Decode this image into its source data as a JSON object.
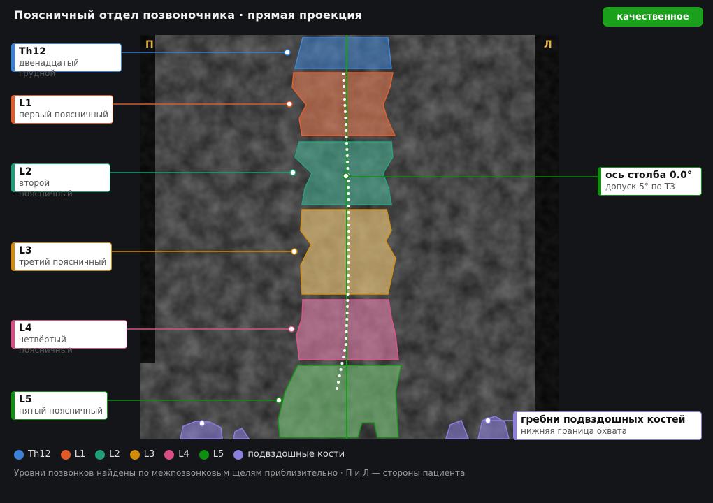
{
  "title": "Поясничный отдел позвоночника · прямая проекция",
  "badge": "качественное",
  "side_right": "П",
  "side_left": "Л",
  "vertebrae": [
    {
      "id": "th12",
      "name": "Th12",
      "desc": "двенадцатый грудной",
      "color": "#3b82d6"
    },
    {
      "id": "l1",
      "name": "L1",
      "desc": "первый поясничный",
      "color": "#e05a2a"
    },
    {
      "id": "l2",
      "name": "L2",
      "desc": "второй поясничный",
      "color": "#1f9e77"
    },
    {
      "id": "l3",
      "name": "L3",
      "desc": "третий поясничный",
      "color": "#d08b0a"
    },
    {
      "id": "l4",
      "name": "L4",
      "desc": "четвёртый поясничный",
      "color": "#d94f85"
    },
    {
      "id": "l5",
      "name": "L5",
      "desc": "пятый поясничный",
      "color": "#0f8f0f"
    }
  ],
  "axis_label": {
    "name": "ось столба 0.0°",
    "desc": "допуск 5° по ТЗ",
    "color": "#0f8f0f"
  },
  "iliac_label": {
    "name": "гребни подвздошных костей",
    "desc": "нижняя граница охвата",
    "color": "#8a7fe0"
  },
  "legend": [
    {
      "label": "Th12",
      "color": "#3b82d6"
    },
    {
      "label": "L1",
      "color": "#e05a2a"
    },
    {
      "label": "L2",
      "color": "#1f9e77"
    },
    {
      "label": "L3",
      "color": "#d08b0a"
    },
    {
      "label": "L4",
      "color": "#d94f85"
    },
    {
      "label": "L5",
      "color": "#0f8f0f"
    },
    {
      "label": "подвздошные кости",
      "color": "#8a7fe0"
    }
  ],
  "footer": "Уровни позвонков найдены по межпозвонковым щелям приблизительно · П и Л — стороны пациента"
}
